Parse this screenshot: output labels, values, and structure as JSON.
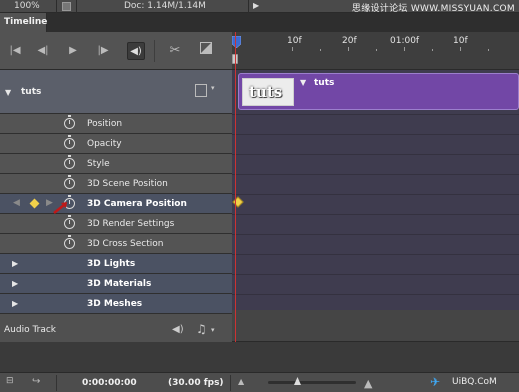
{
  "status_bar": {
    "zoom": "100%",
    "doc_info": "Doc: 1.14M/1.14M",
    "watermark": "思缘设计论坛  WWW.MISSYUAN.COM"
  },
  "panel": {
    "tab_label": "Timeline"
  },
  "controls": {
    "icons": [
      "go-to-first-frame-icon",
      "previous-frame-icon",
      "play-icon",
      "next-frame-icon",
      "audio-icon",
      "split-at-playhead-icon",
      "transition-icon"
    ]
  },
  "ruler": {
    "ticks": [
      "10f",
      "20f",
      "01:00f",
      "10f"
    ]
  },
  "layer": {
    "name": "tuts",
    "clip_name": "tuts",
    "thumb_text": "tuts"
  },
  "properties": [
    {
      "label": "Position"
    },
    {
      "label": "Opacity"
    },
    {
      "label": "Style"
    },
    {
      "label": "3D Scene Position"
    },
    {
      "label": "3D Camera Position",
      "selected": true
    },
    {
      "label": "3D Render Settings"
    },
    {
      "label": "3D Cross Section"
    }
  ],
  "groups": [
    {
      "label": "3D Lights"
    },
    {
      "label": "3D Materials"
    },
    {
      "label": "3D Meshes"
    }
  ],
  "audio": {
    "label": "Audio Track"
  },
  "bottom": {
    "timecode": "0:00:00:00",
    "fps": "(30.00 fps)",
    "watermark_text": "UiBQ.CoM"
  },
  "colors": {
    "clip": "#7247a6",
    "keyframe": "#f2d14a",
    "playhead": "#cc3333",
    "selected_row": "#4b5263"
  }
}
